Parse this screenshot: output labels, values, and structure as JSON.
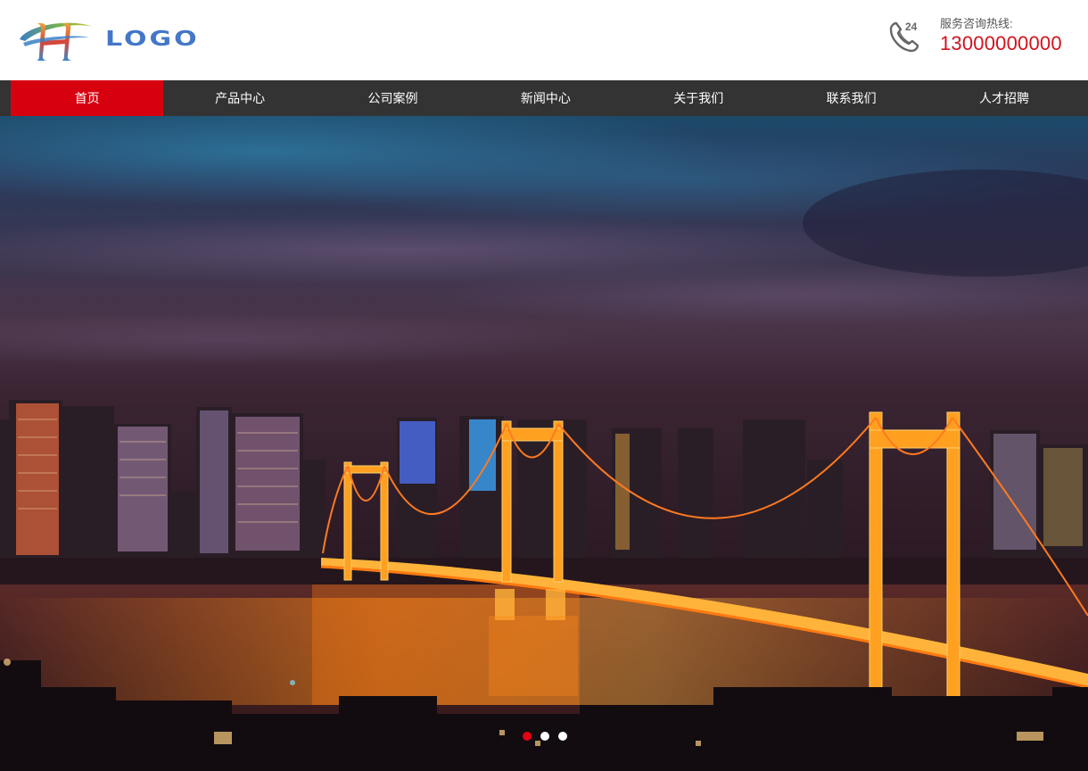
{
  "header": {
    "logo_text": "LOGO",
    "hotline_label": "服务咨询热线:",
    "hotline_number": "13000000000",
    "phone_icon_badge": "24"
  },
  "nav": {
    "items": [
      {
        "label": "首页",
        "active": true
      },
      {
        "label": "产品中心",
        "active": false
      },
      {
        "label": "公司案例",
        "active": false
      },
      {
        "label": "新闻中心",
        "active": false
      },
      {
        "label": "关于我们",
        "active": false
      },
      {
        "label": "联系我们",
        "active": false
      },
      {
        "label": "人才招聘",
        "active": false
      }
    ]
  },
  "banner": {
    "image": "night city skyline with illuminated suspension bridge over river",
    "slide_count": 3,
    "active_slide": 1
  },
  "colors": {
    "accent_red": "#d7000f",
    "nav_background": "#333333",
    "logo_blue": "#4377c8",
    "hotline_red": "#d4121c"
  },
  "icons": [
    "logo-mark-icon",
    "phone-24-icon"
  ]
}
